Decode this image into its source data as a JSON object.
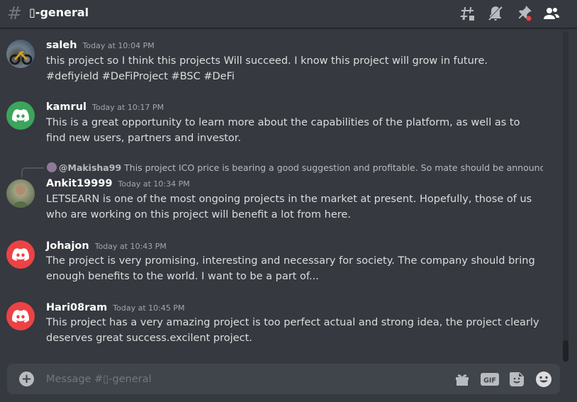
{
  "channel": {
    "hash": "#",
    "name": "▯-general"
  },
  "header_icons": [
    "threads-icon",
    "mute-bell-icon",
    "pin-icon",
    "members-icon"
  ],
  "messages": [
    {
      "user": "saleh",
      "time": "Today at 10:04 PM",
      "text": "this project so I think this projects Will succeed. I know this project will grow in future. #defiyield #DeFiProject #BSC #DeFi",
      "avatar": "photo"
    },
    {
      "user": "kamrul",
      "time": "Today at 10:17 PM",
      "text": "This is a great opportunity to learn more about the capabilities of the platform, as well as to find new users, partners and investor.",
      "avatar": "discord-green",
      "avatar_color": "#3ba55c"
    },
    {
      "user": "Ankit19999",
      "time": "Today at 10:34 PM",
      "text": "LETSEARN  is one of the most ongoing projects in the market at present.  Hopefully, those of us who are working on this project will benefit a lot from here.",
      "avatar": "photo",
      "reply": {
        "user": "@Makisha99",
        "text": "This project ICO price is bearing a good suggestion and profitable. So mate should be announcing ..."
      }
    },
    {
      "user": "Johajon",
      "time": "Today at 10:43 PM",
      "text": "The project is very promising, interesting and necessary for society. The company should bring enough benefits to the world. I want to be a part of...",
      "avatar": "discord-red",
      "avatar_color": "#ed4245"
    },
    {
      "user": "Hari08ram",
      "time": "Today at 10:45 PM",
      "text": "This project has a very amazing project is too perfect  actual and strong idea, the project clearly deserves great success.excilent project.",
      "avatar": "discord-red",
      "avatar_color": "#ed4245"
    }
  ],
  "composer": {
    "placeholder": "Message #▯-general",
    "gif_label": "GIF",
    "icons": [
      "add-icon",
      "gift-icon",
      "gif-icon",
      "sticker-icon",
      "emoji-icon"
    ]
  },
  "colors": {
    "background": "#36393f",
    "input_bg": "#40444b",
    "discord_green": "#3ba55c",
    "discord_red": "#ed4245"
  }
}
